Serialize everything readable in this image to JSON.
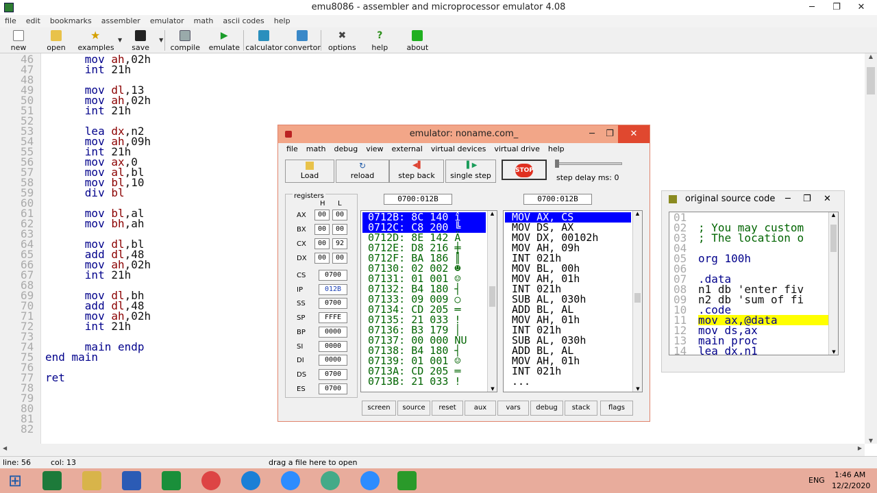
{
  "window": {
    "title": "emu8086 - assembler and microprocessor emulator 4.08",
    "minimize": "─",
    "maximize": "❐",
    "close": "✕"
  },
  "menu": [
    "file",
    "edit",
    "bookmarks",
    "assembler",
    "emulator",
    "math",
    "ascii codes",
    "help"
  ],
  "toolbar": {
    "new": "new",
    "open": "open",
    "examples": "examples",
    "save": "save",
    "compile": "compile",
    "emulate": "emulate",
    "calculator": "calculator",
    "convertor": "convertor",
    "options": "options",
    "help": "help",
    "about": "about"
  },
  "editor": {
    "line_numbers": [
      "46",
      "47",
      "48",
      "49",
      "50",
      "51",
      "52",
      "53",
      "54",
      "55",
      "56",
      "57",
      "58",
      "59",
      "60",
      "61",
      "62",
      "63",
      "64",
      "65",
      "66",
      "67",
      "68",
      "69",
      "70",
      "71",
      "72",
      "73",
      "74",
      "75",
      "76",
      "77",
      "78",
      "79",
      "80",
      "81",
      "82"
    ],
    "lines": [
      {
        "op": "mov",
        "a": "ah",
        "b": ",02h"
      },
      {
        "op": "int",
        "a": "",
        "b": "21h"
      },
      {
        "op": "",
        "a": "",
        "b": ""
      },
      {
        "op": "mov",
        "a": "dl",
        "b": ",13"
      },
      {
        "op": "mov",
        "a": "ah",
        "b": ",02h"
      },
      {
        "op": "int",
        "a": "",
        "b": "21h"
      },
      {
        "op": "",
        "a": "",
        "b": ""
      },
      {
        "op": "lea",
        "a": "dx",
        "b": ",n2"
      },
      {
        "op": "mov",
        "a": "ah",
        "b": ",09h"
      },
      {
        "op": "int",
        "a": "",
        "b": "21h"
      },
      {
        "op": "mov",
        "a": "ax",
        "b": ",0"
      },
      {
        "op": "mov",
        "a": "al",
        "b": ",bl"
      },
      {
        "op": "mov",
        "a": "bl",
        "b": ",10"
      },
      {
        "op": "div",
        "a": "bl",
        "b": ""
      },
      {
        "op": "",
        "a": "",
        "b": ""
      },
      {
        "op": "mov",
        "a": "bl",
        "b": ",al"
      },
      {
        "op": "mov",
        "a": "bh",
        "b": ",ah"
      },
      {
        "op": "",
        "a": "",
        "b": ""
      },
      {
        "op": "mov",
        "a": "dl",
        "b": ",bl"
      },
      {
        "op": "add",
        "a": "dl",
        "b": ",48"
      },
      {
        "op": "mov",
        "a": "ah",
        "b": ",02h"
      },
      {
        "op": "int",
        "a": "",
        "b": "21h"
      },
      {
        "op": "",
        "a": "",
        "b": ""
      },
      {
        "op": "mov",
        "a": "dl",
        "b": ",bh"
      },
      {
        "op": "add",
        "a": "dl",
        "b": ",48"
      },
      {
        "op": "mov",
        "a": "ah",
        "b": ",02h"
      },
      {
        "op": "int",
        "a": "",
        "b": "21h"
      },
      {
        "op": "",
        "a": "",
        "b": ""
      },
      {
        "op": "main endp",
        "a": "",
        "b": ""
      },
      {
        "op": "end main",
        "a": "",
        "b": ""
      },
      {
        "op": "",
        "a": "",
        "b": ""
      },
      {
        "op": "ret",
        "a": "",
        "b": ""
      }
    ]
  },
  "status": {
    "line": "line: 56",
    "col": "col: 13",
    "hint": "drag a file here to open"
  },
  "taskbar": {
    "lang": "ENG",
    "time": "1:46 AM",
    "date": "12/2/2020"
  },
  "emulator": {
    "title": "emulator: noname.com_",
    "menu": [
      "file",
      "math",
      "debug",
      "view",
      "external",
      "virtual devices",
      "virtual drive",
      "help"
    ],
    "buttons": {
      "load": "Load",
      "reload": "reload",
      "step_back": "step back",
      "single_step": "single step",
      "stop": "STOP"
    },
    "step_delay": "step delay ms: 0",
    "registers_label": "registers",
    "h": "H",
    "l": "L",
    "regs8": [
      {
        "name": "AX",
        "h": "00",
        "l": "00"
      },
      {
        "name": "BX",
        "h": "00",
        "l": "00"
      },
      {
        "name": "CX",
        "h": "00",
        "l": "92"
      },
      {
        "name": "DX",
        "h": "00",
        "l": "00"
      }
    ],
    "regs16": [
      {
        "name": "CS",
        "v": "0700"
      },
      {
        "name": "IP",
        "v": "012B"
      },
      {
        "name": "SS",
        "v": "0700"
      },
      {
        "name": "SP",
        "v": "FFFE"
      },
      {
        "name": "BP",
        "v": "0000"
      },
      {
        "name": "SI",
        "v": "0000"
      },
      {
        "name": "DI",
        "v": "0000"
      },
      {
        "name": "DS",
        "v": "0700"
      },
      {
        "name": "ES",
        "v": "0700"
      }
    ],
    "mem_addr": "0700:012B",
    "dis_addr": "0700:012B",
    "memory": [
      "0712B: 8C 140 î",
      "0712C: C8 200 ╚",
      "0712D: 8E 142 Ä",
      "0712E: D8 216 ╪",
      "0712F: BA 186 ║",
      "07130: 02 002 ☻",
      "07131: 01 001 ☺",
      "07132: B4 180 ┤",
      "07133: 09 009 ○",
      "07134: CD 205 ═",
      "07135: 21 033 !",
      "07136: B3 179 │",
      "07137: 00 000 NU",
      "07138: B4 180 ┤",
      "07139: 01 001 ☺",
      "0713A: CD 205 ═",
      "0713B: 21 033 !"
    ],
    "disasm": [
      "MOV AX, CS",
      "MOV DS, AX",
      "MOV DX, 00102h",
      "MOV AH, 09h",
      "INT 021h",
      "MOV BL, 00h",
      "MOV AH, 01h",
      "INT 021h",
      "SUB AL, 030h",
      "ADD BL, AL",
      "MOV AH, 01h",
      "INT 021h",
      "SUB AL, 030h",
      "ADD BL, AL",
      "MOV AH, 01h",
      "INT 021h",
      "..."
    ],
    "bottom": [
      "screen",
      "source",
      "reset",
      "aux",
      "vars",
      "debug",
      "stack",
      "flags"
    ]
  },
  "source": {
    "title": "original source code",
    "line_numbers": [
      "01",
      "02",
      "03",
      "04",
      "05",
      "06",
      "07",
      "08",
      "09",
      "10",
      "11",
      "12",
      "13",
      "14"
    ],
    "lines": [
      {
        "t": "",
        "c": ""
      },
      {
        "t": "; You may custom",
        "c": "cm"
      },
      {
        "t": "; The location o",
        "c": "cm"
      },
      {
        "t": "",
        "c": ""
      },
      {
        "t": "org 100h",
        "c": ""
      },
      {
        "t": "",
        "c": ""
      },
      {
        "t": ".data",
        "c": ""
      },
      {
        "t": "n1 db 'enter fiv",
        "c": "st"
      },
      {
        "t": "n2 db 'sum of fi",
        "c": "st"
      },
      {
        "t": ".code",
        "c": ""
      },
      {
        "t": "mov ax,@data",
        "c": "hl"
      },
      {
        "t": "mov ds,ax",
        "c": ""
      },
      {
        "t": "main proc",
        "c": ""
      },
      {
        "t": "lea dx,n1",
        "c": ""
      }
    ]
  },
  "colors": {
    "accent": "#f2a688",
    "selection": "#0000ff",
    "highlight": "#ffff00"
  }
}
